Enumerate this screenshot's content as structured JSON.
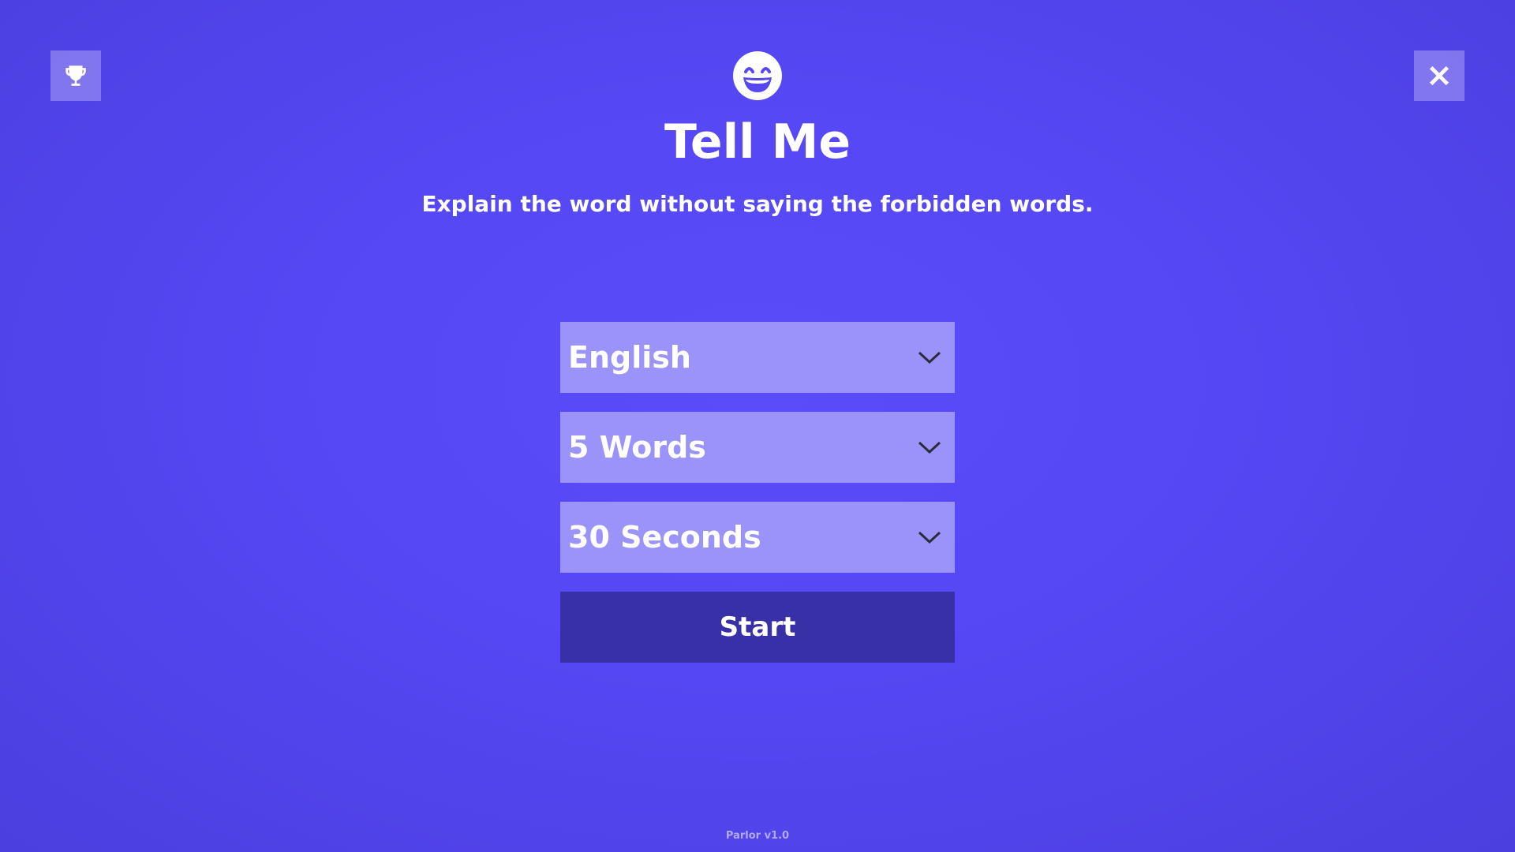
{
  "colors": {
    "background": "#5547f3",
    "select_background": "#9a93f9",
    "start_background": "#3830a6",
    "corner_button_background": "#8d84f7"
  },
  "toolbar": {
    "leaderboard_icon": "trophy-icon",
    "close_icon": "close-icon"
  },
  "header": {
    "logo_icon": "grinning-face-icon",
    "title": "Tell Me",
    "subtitle": "Explain the word without saying the forbidden words."
  },
  "settings": {
    "language": {
      "value": "English",
      "icon": "chevron-down-icon"
    },
    "word_count": {
      "value": "5 Words",
      "icon": "chevron-down-icon"
    },
    "duration": {
      "value": "30 Seconds",
      "icon": "chevron-down-icon"
    }
  },
  "start_button": {
    "label": "Start"
  },
  "footer": {
    "version": "Parlor v1.0"
  }
}
